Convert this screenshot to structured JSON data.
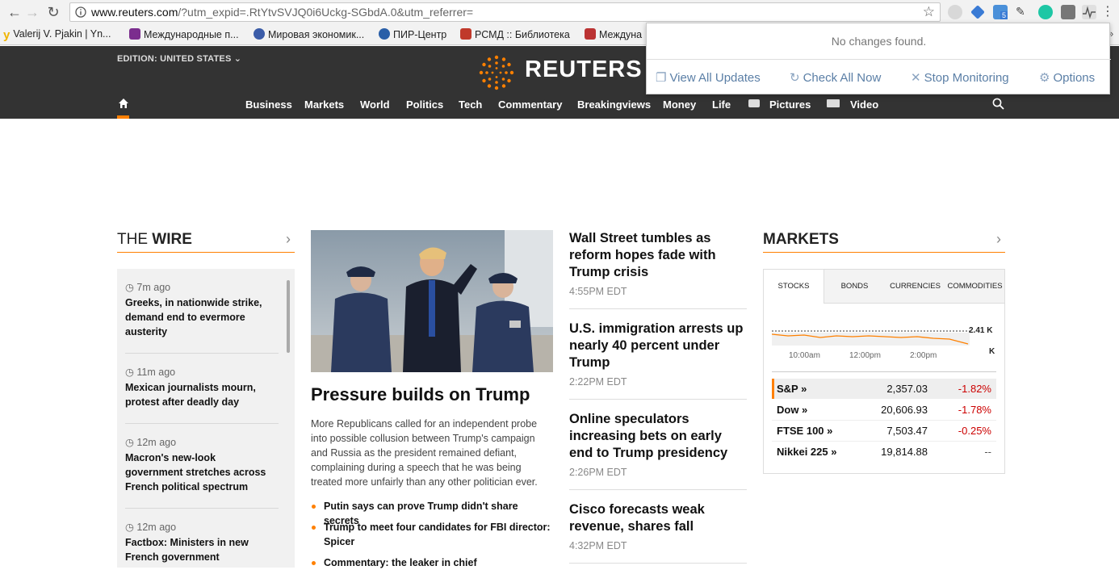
{
  "browser": {
    "url_host": "www.reuters.com",
    "url_rest": "/?utm_expid=.RtYtvSVJQ0i6Uckg-SGbdA.0&utm_referrer=",
    "bookmarks": [
      {
        "label": "Valerij V. Pjakin | Yn...",
        "color": "#f0b400"
      },
      {
        "label": "Международные п...",
        "color": "#7b2d8e"
      },
      {
        "label": "Мировая экономик...",
        "color": "#3b5ca8"
      },
      {
        "label": "ПИР-Центр",
        "color": "#2a5fa8"
      },
      {
        "label": "РСМД :: Библиотека",
        "color": "#c0392b"
      },
      {
        "label": "Междуна",
        "color": "#b33"
      }
    ],
    "extension_badge": "5"
  },
  "popup": {
    "message": "No changes found.",
    "view_all": "View All Updates",
    "check_all": "Check All Now",
    "stop": "Stop Monitoring",
    "options": "Options"
  },
  "header": {
    "edition": "EDITION: UNITED STATES",
    "logo": "REUTERS",
    "nav": [
      "Business",
      "Markets",
      "World",
      "Politics",
      "Tech",
      "Commentary",
      "Breakingviews",
      "Money",
      "Life",
      "Pictures",
      "Video"
    ]
  },
  "wire": {
    "title_a": "THE ",
    "title_b": "WIRE",
    "items": [
      {
        "time": "7m ago",
        "headline": "Greeks, in nationwide strike, demand end to evermore austerity"
      },
      {
        "time": "11m ago",
        "headline": "Mexican journalists mourn, protest after deadly day"
      },
      {
        "time": "12m ago",
        "headline": "Macron's new-look government stretches across French political spectrum"
      },
      {
        "time": "12m ago",
        "headline": "Factbox: Ministers in new French government"
      }
    ]
  },
  "lead": {
    "title": "Pressure builds on Trump",
    "body": "More Republicans called for an independent probe into possible collusion between Trump's campaign and Russia as the president remained defiant, complaining during a speech that he was being treated more unfairly than any other politician ever.",
    "bullets": [
      "Putin says can prove Trump didn't share secrets",
      "Trump to meet four candidates for FBI director: Spicer",
      "Commentary: the leaker in chief"
    ]
  },
  "middle": [
    {
      "headline": "Wall Street tumbles as reform hopes fade with Trump crisis",
      "time": "4:55PM EDT"
    },
    {
      "headline": "U.S. immigration arrests up nearly 40 percent under Trump",
      "time": "2:22PM EDT"
    },
    {
      "headline": "Online speculators increasing bets on early end to Trump presidency",
      "time": "2:26PM EDT"
    },
    {
      "headline": "Cisco forecasts weak revenue, shares fall",
      "time": "4:32PM EDT"
    }
  ],
  "markets": {
    "title": "MARKETS",
    "tabs": [
      "STOCKS",
      "BONDS",
      "CURRENCIES",
      "COMMODITIES"
    ],
    "chart_labels": {
      "level": "2.41 K",
      "unit": "K",
      "times": [
        "10:00am",
        "12:00pm",
        "2:00pm"
      ]
    },
    "rows": [
      {
        "name": "S&P »",
        "value": "2,357.03",
        "change": "-1.82%"
      },
      {
        "name": "Dow »",
        "value": "20,606.93",
        "change": "-1.78%"
      },
      {
        "name": "FTSE 100 »",
        "value": "7,503.47",
        "change": "-0.25%"
      },
      {
        "name": "Nikkei 225 »",
        "value": "19,814.88",
        "change": "--"
      }
    ],
    "accent": "#ff8000"
  }
}
